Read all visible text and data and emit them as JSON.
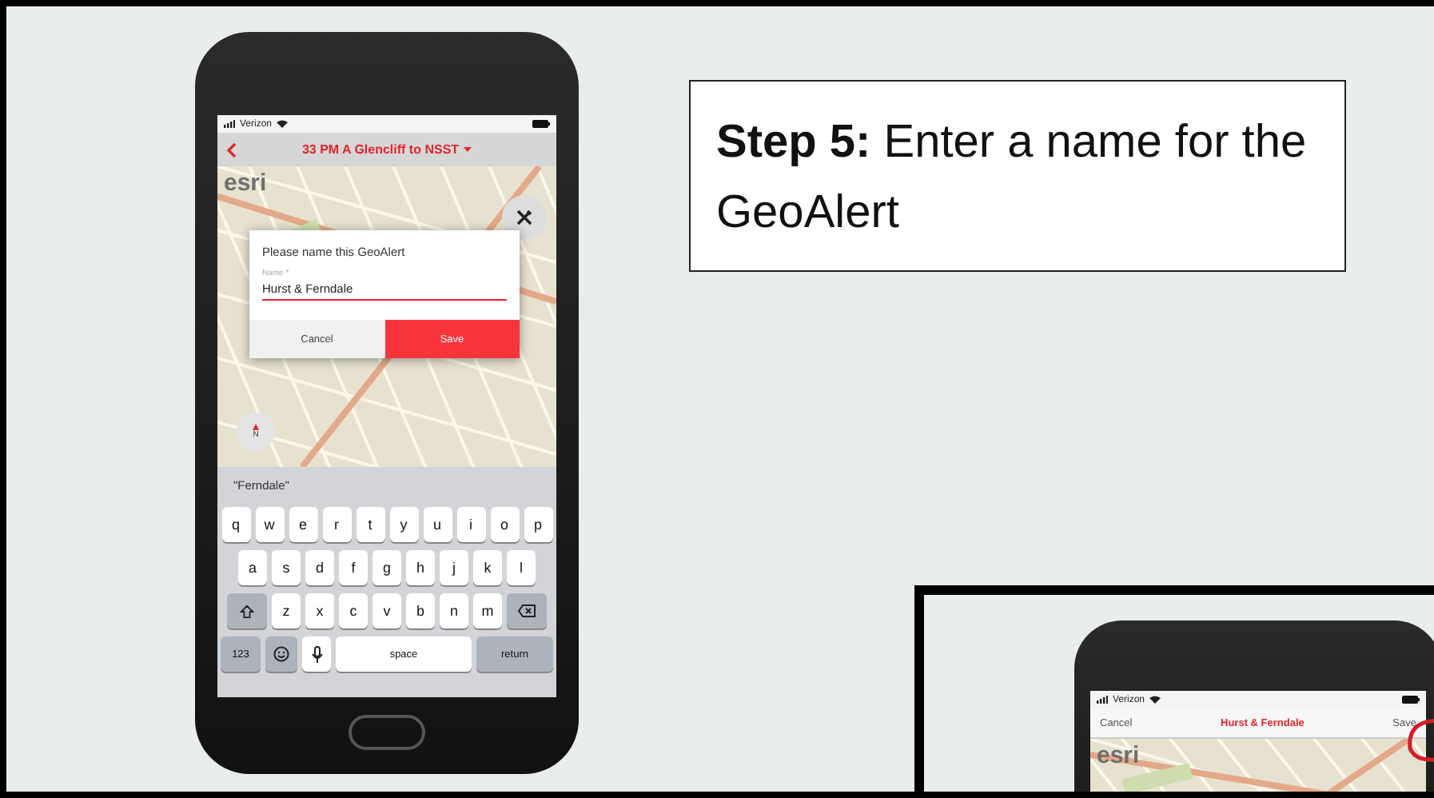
{
  "callout": {
    "text": "**Step 5:** Enter a name for the GeoAlert"
  },
  "phone": {
    "status_bar": {
      "carrier": "Verizon"
    },
    "nav": {
      "title": "33 PM A Glencliff to NSST"
    },
    "map": {
      "logo": "esri",
      "compass": "N"
    },
    "dialog": {
      "title": "Please name this GeoAlert",
      "field_label": "Name *",
      "value": "Hurst & Ferndale",
      "buttons": [
        {
          "label": "Cancel",
          "kind": "secondary"
        },
        {
          "label": "Save",
          "kind": "primary"
        }
      ]
    },
    "suggestion": "\"Ferndale\"",
    "keyboard": [
      [
        {
          "kind": "letter",
          "label": "q"
        },
        {
          "kind": "letter",
          "label": "w"
        },
        {
          "kind": "letter",
          "label": "e"
        },
        {
          "kind": "letter",
          "label": "r"
        },
        {
          "kind": "letter",
          "label": "t"
        },
        {
          "kind": "letter",
          "label": "y"
        },
        {
          "kind": "letter",
          "label": "u"
        },
        {
          "kind": "letter",
          "label": "i"
        },
        {
          "kind": "letter",
          "label": "o"
        },
        {
          "kind": "letter",
          "label": "p"
        }
      ],
      [
        {
          "kind": "letter",
          "label": "a"
        },
        {
          "kind": "letter",
          "label": "s"
        },
        {
          "kind": "letter",
          "label": "d"
        },
        {
          "kind": "letter",
          "label": "f"
        },
        {
          "kind": "letter",
          "label": "g"
        },
        {
          "kind": "letter",
          "label": "h"
        },
        {
          "kind": "letter",
          "label": "j"
        },
        {
          "kind": "letter",
          "label": "k"
        },
        {
          "kind": "letter",
          "label": "l"
        }
      ],
      [
        {
          "kind": "shift"
        },
        {
          "kind": "letter",
          "label": "z"
        },
        {
          "kind": "letter",
          "label": "x"
        },
        {
          "kind": "letter",
          "label": "c"
        },
        {
          "kind": "letter",
          "label": "v"
        },
        {
          "kind": "letter",
          "label": "b"
        },
        {
          "kind": "letter",
          "label": "n"
        },
        {
          "kind": "letter",
          "label": "m"
        },
        {
          "kind": "delete"
        }
      ],
      [
        {
          "kind": "mode",
          "label": "123"
        },
        {
          "kind": "emoji"
        },
        {
          "kind": "mic"
        },
        {
          "kind": "space",
          "label": "space"
        },
        {
          "kind": "return",
          "label": "return"
        }
      ]
    ]
  },
  "inset_phone": {
    "status_bar": {
      "carrier": "Verizon"
    },
    "nav": {
      "left": "Cancel",
      "title": "Hurst & Ferndale",
      "right": "Save"
    },
    "map": {
      "logo": "esri"
    }
  }
}
